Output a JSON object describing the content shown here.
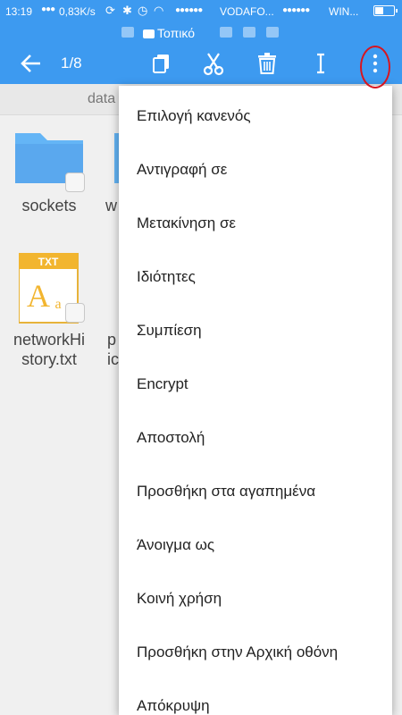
{
  "status_bar": {
    "time": "13:19",
    "network_speed": "0,83K/s",
    "carrier1": "VODAFO...",
    "carrier2": "WIN..."
  },
  "location_bar": {
    "label": "Τοπικό"
  },
  "toolbar": {
    "selection_count": "1/8",
    "icons": [
      "back-arrow-icon",
      "copy-icon",
      "cut-icon",
      "delete-icon",
      "rename-icon",
      "more-options-icon"
    ]
  },
  "path_bar": {
    "path": "data"
  },
  "files": [
    {
      "name": "sockets",
      "type": "folder"
    },
    {
      "name": "w",
      "type": "folder"
    },
    {
      "name": "networkHi\nstory.txt",
      "type": "txt",
      "badge": "TXT"
    },
    {
      "name": "p\nic",
      "type": "file"
    }
  ],
  "menu": {
    "items": [
      "Επιλογή κανενός",
      "Αντιγραφή σε",
      "Μετακίνηση σε",
      "Ιδιότητες",
      "Συμπίεση",
      "Encrypt",
      "Αποστολή",
      "Προσθήκη στα αγαπημένα",
      "Άνοιγμα ως",
      "Κοινή χρήση",
      "Προσθήκη στην Αρχική οθόνη",
      "Απόκρυψη"
    ]
  },
  "colors": {
    "primary": "#3d9af0",
    "folder": "#64b5f6",
    "txt_badge": "#f2b52f",
    "highlight_circle": "#d8151f"
  }
}
